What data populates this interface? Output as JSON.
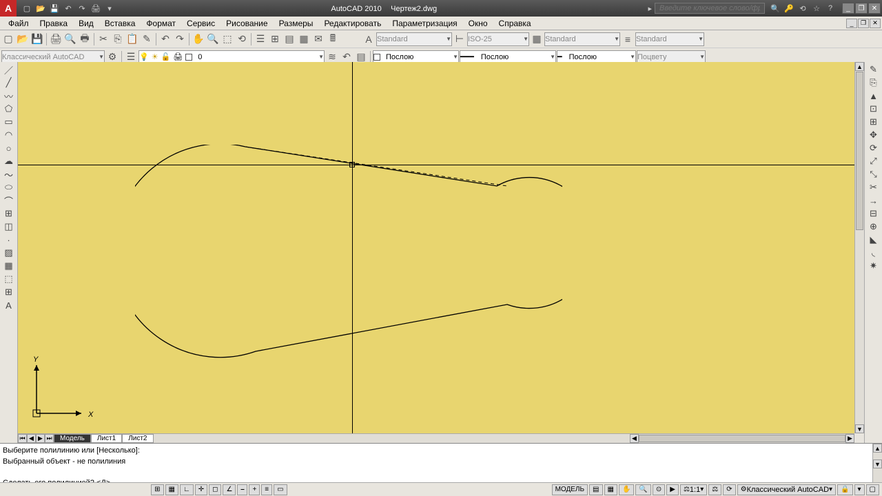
{
  "title": {
    "app": "AutoCAD 2010",
    "file": "Чертеж2.dwg"
  },
  "search_placeholder": "Введите ключевое слово/фразу",
  "menu": [
    "Файл",
    "Правка",
    "Вид",
    "Вставка",
    "Формат",
    "Сервис",
    "Рисование",
    "Размеры",
    "Редактировать",
    "Параметризация",
    "Окно",
    "Справка"
  ],
  "workspace": "Классический AutoCAD",
  "layer_value": "0",
  "dropdowns": {
    "textstyle": "Standard",
    "dimstyle": "ISO-25",
    "tablestyle": "Standard",
    "mlstyle": "Standard",
    "color": "Послою",
    "ltype": "Послою",
    "lweight": "Послою",
    "plot": "Поцвету"
  },
  "tabs": {
    "model": "Модель",
    "l1": "Лист1",
    "l2": "Лист2"
  },
  "ucs": {
    "x": "X",
    "y": "Y"
  },
  "cmd_lines": [
    "Выберите полилинию или [Несколько]:",
    "Выбранный объект - не полилиния",
    "Сделать его полилинией? <Д>"
  ],
  "status": {
    "model": "МОДЕЛЬ",
    "scale": "1:1",
    "ws": "Классический AutoCAD"
  }
}
